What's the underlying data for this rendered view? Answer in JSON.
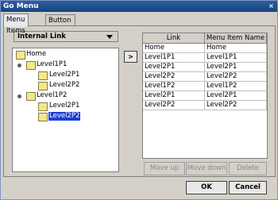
{
  "window": {
    "title": "Go Menu",
    "close_symbol": "×"
  },
  "tabs": [
    {
      "label": "Menu Items",
      "active": true
    },
    {
      "label": "Button Format",
      "active": false
    }
  ],
  "link_type": {
    "selected": "Internal Link"
  },
  "move_right_symbol": ">",
  "tree": {
    "nodes": [
      {
        "label": "Home"
      },
      {
        "label": "Level1P1"
      },
      {
        "label": "Level2P1"
      },
      {
        "label": "Level2P2"
      },
      {
        "label": "Level1P2"
      },
      {
        "label": "Level2P1"
      },
      {
        "label": "Level2P2",
        "selected": true
      }
    ]
  },
  "table": {
    "headers": [
      "Link",
      "Menu Item Name"
    ],
    "rows": [
      [
        "Home",
        "Home"
      ],
      [
        "Level1P1",
        "Level1P1"
      ],
      [
        "Level2P1",
        "Level2P1"
      ],
      [
        "Level2P2",
        "Level2P2"
      ],
      [
        "Level1P2",
        "Level1P2"
      ],
      [
        "Level2P1",
        "Level2P1"
      ],
      [
        "Level2P2",
        "Level2P2"
      ]
    ]
  },
  "buttons": {
    "move_up": "Move up",
    "move_down": "Move down",
    "delete": "Delete",
    "ok": "OK",
    "cancel": "Cancel"
  }
}
